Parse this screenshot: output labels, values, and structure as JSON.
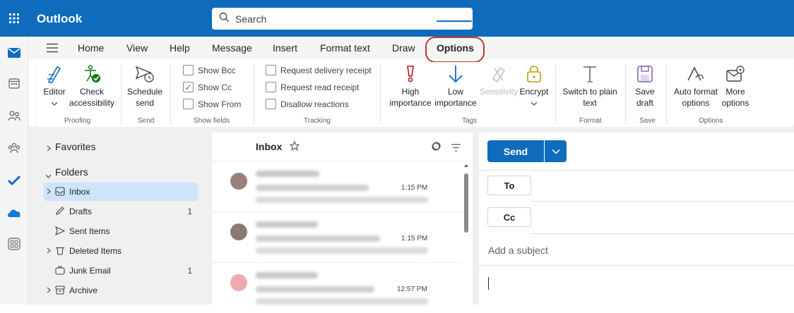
{
  "app": {
    "title": "Outlook",
    "brand_color": "#0f6cbd"
  },
  "search": {
    "placeholder": "Search"
  },
  "tabs": [
    "Home",
    "View",
    "Help",
    "Message",
    "Insert",
    "Format text",
    "Draw",
    "Options"
  ],
  "active_tab": "Options",
  "ribbon": {
    "editor": "Editor",
    "check_accessibility": [
      "Check",
      "accessibility"
    ],
    "schedule_send": [
      "Schedule",
      "send"
    ],
    "show_bcc": "Show Bcc",
    "show_cc": "Show Cc",
    "show_from": "Show From",
    "request_delivery": "Request delivery receipt",
    "request_read": "Request read receipt",
    "disallow_reactions": "Disallow reactions",
    "high_importance": [
      "High",
      "importance"
    ],
    "low_importance": [
      "Low",
      "importance"
    ],
    "sensitivity": "Sensitivity",
    "encrypt": "Encrypt",
    "switch_plain": [
      "Switch to plain",
      "text"
    ],
    "save_draft": [
      "Save",
      "draft"
    ],
    "auto_format": [
      "Auto format",
      "options"
    ],
    "more_options": [
      "More",
      "options"
    ],
    "groups": {
      "proofing": "Proofing",
      "send": "Send",
      "show_fields": "Show fields",
      "tracking": "Tracking",
      "tags": "Tags",
      "format": "Format",
      "save": "Save",
      "options": "Options"
    }
  },
  "folders": {
    "favorites": "Favorites",
    "folders": "Folders",
    "items": [
      {
        "label": "Inbox",
        "count": ""
      },
      {
        "label": "Drafts",
        "count": "1"
      },
      {
        "label": "Sent Items",
        "count": ""
      },
      {
        "label": "Deleted Items",
        "count": ""
      },
      {
        "label": "Junk Email",
        "count": "1"
      },
      {
        "label": "Archive",
        "count": ""
      }
    ]
  },
  "message_list": {
    "header": "Inbox",
    "times": [
      "1:15 PM",
      "1:15 PM",
      "12:57 PM"
    ]
  },
  "compose": {
    "send": "Send",
    "to": "To",
    "cc": "Cc",
    "subject_placeholder": "Add a subject"
  },
  "icons": [
    "app-launcher-icon",
    "search-icon",
    "mail-icon",
    "calendar-icon",
    "people-icon",
    "groups-icon",
    "todo-icon",
    "onedrive-icon",
    "apps-icon",
    "hamburger-icon"
  ]
}
